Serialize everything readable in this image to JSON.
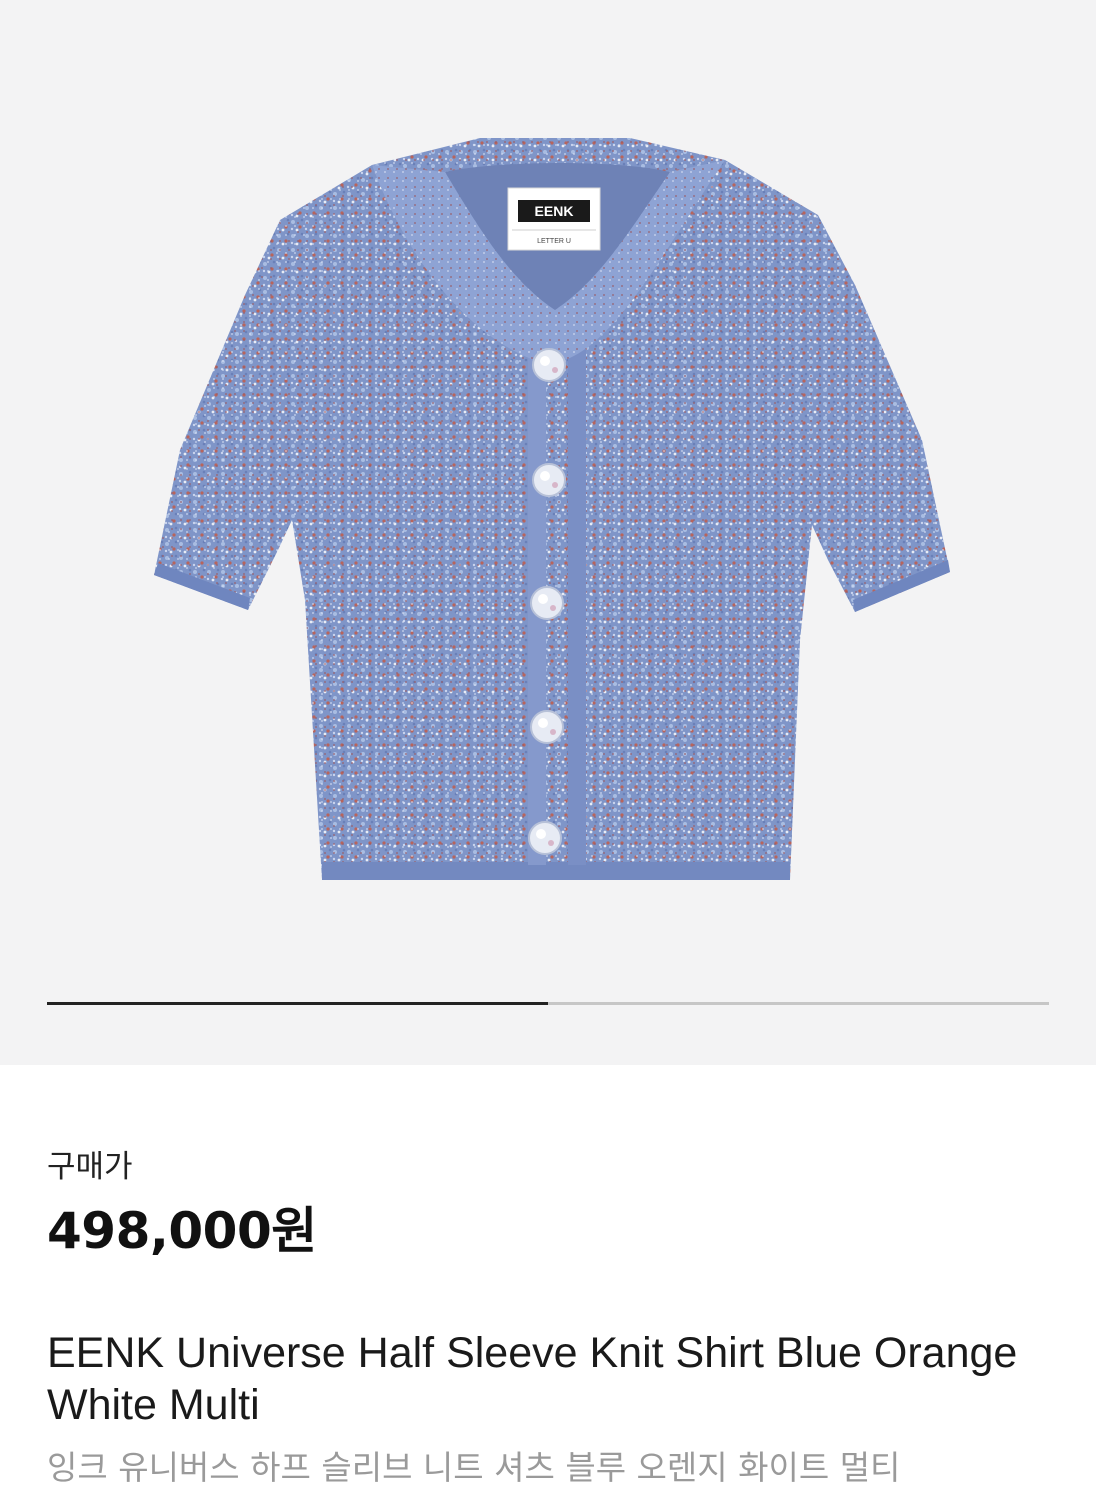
{
  "gallery": {
    "image_alt": "EENK Universe Half Sleeve Knit Shirt",
    "label_brand": "EENK",
    "label_sub": "LETTER U",
    "progress_fraction": 0.5,
    "colors": {
      "knit_base": "#7f95c8",
      "knit_light": "#a9bde2",
      "knit_red": "#b8645c",
      "knit_white": "#e8ecf5",
      "track": "#c6c6c6",
      "fill": "#222222"
    }
  },
  "product": {
    "price_label": "구매가",
    "price": "498,000원",
    "title_en": "EENK Universe Half Sleeve Knit Shirt Blue Orange White Multi",
    "title_ko": "잉크 유니버스 하프 슬리브 니트 셔츠 블루 오렌지 화이트 멀티"
  }
}
